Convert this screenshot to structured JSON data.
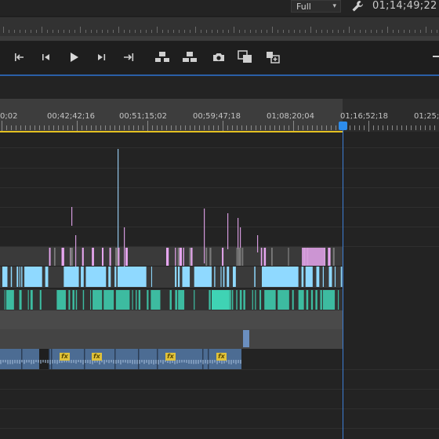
{
  "monitor": {
    "quality": "Full",
    "timecode": "01;14;49;22"
  },
  "icons": {
    "settings": "wrench-icon",
    "mark_in": "mark-in-icon",
    "step_back": "step-back-icon",
    "play": "play-icon",
    "step_forward": "step-forward-icon",
    "mark_out": "mark-out-icon",
    "lift": "lift-icon",
    "extract": "extract-icon",
    "export_frame": "camera-icon",
    "overwrite": "overwrite-icon",
    "insert": "insert-icon"
  },
  "timeline": {
    "ruler_labels": [
      "0;02",
      "00;42;42;16",
      "00;51;15;02",
      "00;59;47;18",
      "01;08;20;04",
      "01;16;52;18",
      "01;25;"
    ]
  },
  "colors": {
    "playhead": "#2d8ceb",
    "work_area": "#e3c021",
    "video_clip": "#8fd9ff",
    "audio_clip": "#3fd3b4",
    "graphic_clip": "#e6a6ef",
    "fx_badge": "#e0c23b",
    "clip_row": "#4c6c93"
  }
}
